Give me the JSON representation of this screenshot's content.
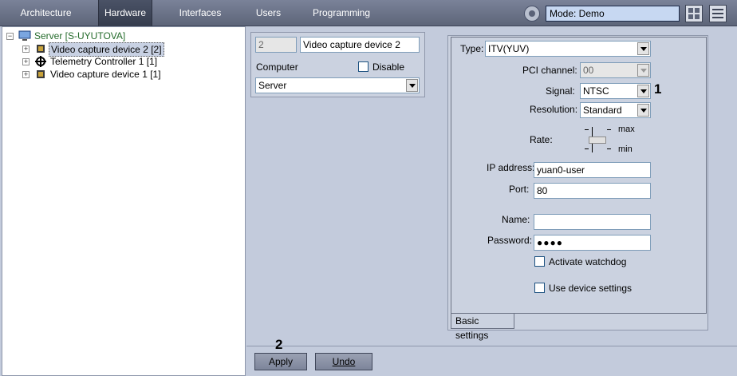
{
  "topbar": {
    "tabs": [
      "Architecture",
      "Hardware",
      "Interfaces",
      "Users",
      "Programming"
    ],
    "active_tab": "Hardware",
    "mode": "Mode: Demo"
  },
  "tree": {
    "root": "Server [S-UYUTOVA]",
    "items": [
      {
        "label": "Video capture device 2 [2]",
        "selected": true
      },
      {
        "label": "Telemetry Controller 1 [1]",
        "selected": false
      },
      {
        "label": "Video capture device 1 [1]",
        "selected": false
      }
    ]
  },
  "device": {
    "id": "2",
    "name": "Video capture device 2",
    "computer_label": "Computer",
    "disable_label": "Disable",
    "computer_value": "Server"
  },
  "settings": {
    "type_label": "Type:",
    "type_value": "ITV(YUV)",
    "pci_label": "PCI channel:",
    "pci_value": "00",
    "signal_label": "Signal:",
    "signal_value": "NTSC",
    "resolution_label": "Resolution:",
    "resolution_value": "Standard",
    "rate_label": "Rate:",
    "rate_max": "max",
    "rate_min": "min",
    "ip_label": "IP address:",
    "ip_value": "yuan0-user",
    "port_label": "Port:",
    "port_value": "80",
    "name_label": "Name:",
    "name_value": "",
    "password_label": "Password:",
    "password_value": "●●●●",
    "watchdog_label": "Activate watchdog",
    "device_settings_label": "Use device settings",
    "tab_label": "Basic settings"
  },
  "actions": {
    "apply_label": "Apply",
    "undo_label": "Undo"
  },
  "callouts": {
    "one": "1",
    "two": "2"
  }
}
